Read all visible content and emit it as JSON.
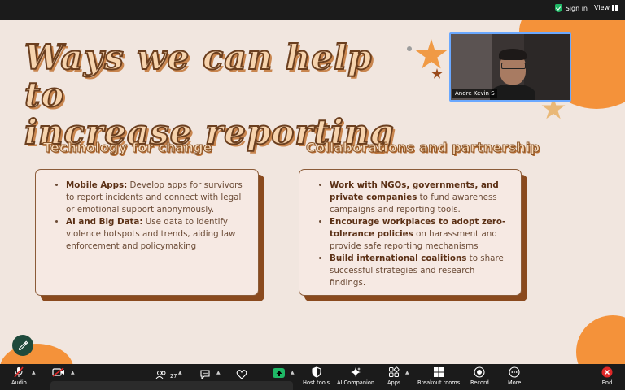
{
  "topbar": {
    "sign_in": "Sign in",
    "view": "View"
  },
  "slide": {
    "title_line1": "Ways we can help to",
    "title_line2": "increase reporting",
    "left_heading": "Technology for change",
    "right_heading": "Collaborations and partnership",
    "left_items": [
      {
        "bold": "Mobile Apps:",
        "text": " Develop apps for survivors to report incidents and connect with legal or emotional support anonymously."
      },
      {
        "bold": "AI and Big Data:",
        "text": " Use data to identify violence hotspots and trends, aiding law enforcement and policymaking"
      }
    ],
    "right_items": [
      {
        "bold": "Work with NGOs, governments, and private companies",
        "text": " to fund awareness campaigns and reporting tools."
      },
      {
        "bold": "Encourage workplaces to adopt zero-tolerance policies",
        "text": " on harassment and provide safe reporting mechanisms"
      },
      {
        "bold": "Build international coalitions",
        "text": " to share successful strategies and research findings."
      }
    ]
  },
  "video": {
    "participant_name": "Andre Kevin S"
  },
  "toolbar": {
    "audio": "Audio",
    "participants_count": "27",
    "host_tools": "Host tools",
    "ai_companion": "AI Companion",
    "apps": "Apps",
    "breakout_rooms": "Breakout rooms",
    "record": "Record",
    "more": "More",
    "end": "End"
  },
  "colors": {
    "accent_orange": "#f4923a",
    "share_green": "#1fb866",
    "end_red": "#e02828"
  }
}
